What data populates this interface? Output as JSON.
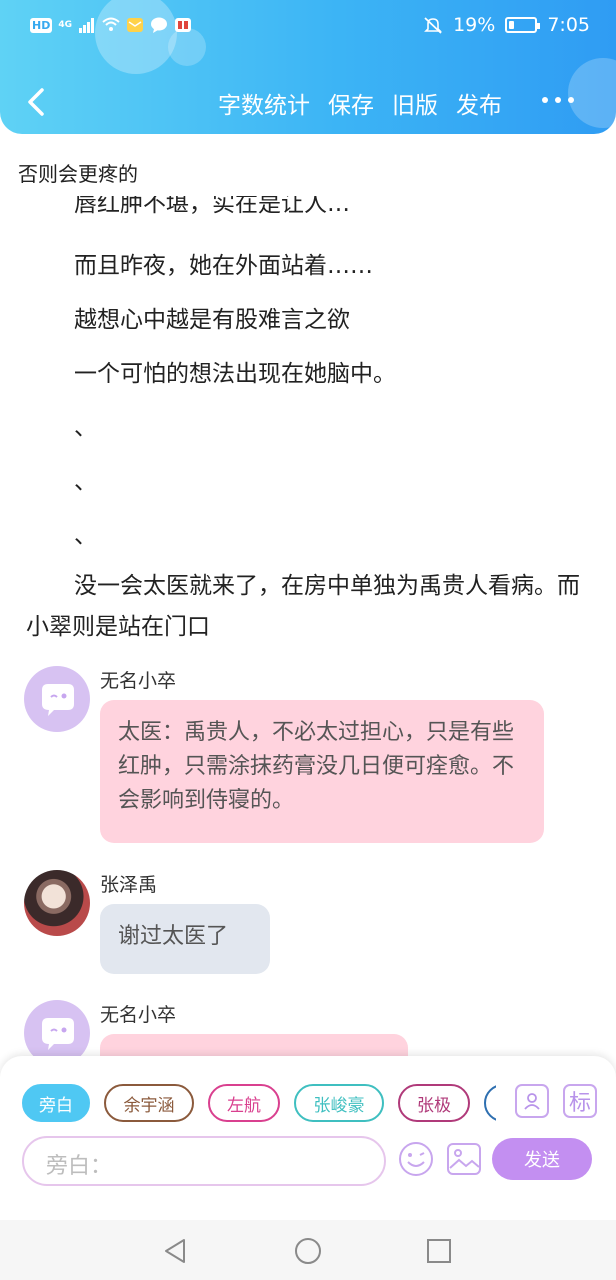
{
  "statusbar": {
    "hd": "HD",
    "network": "4G",
    "battery_percent": "19%",
    "battery_level": 0.19,
    "time": "7:05",
    "icons": [
      "signal-icon",
      "wifi-icon",
      "mail-app-icon",
      "chat-app-icon",
      "book-app-icon",
      "mute-icon",
      "battery-icon"
    ]
  },
  "navbar": {
    "word_count": "字数统计",
    "save": "保存",
    "old_version": "旧版",
    "publish": "发布"
  },
  "draft_title": "否则会更疼的",
  "content": {
    "clipped_line": "唇红肿不堪，实在是让人…",
    "p1": "而且昨夜，她在外面站着……",
    "p2": "越想心中越是有股难言之欲",
    "p3": "一个可怕的想法出现在她脑中。",
    "mark1": "、",
    "mark2": "、",
    "mark3": "、",
    "p4": "没一会太医就来了，在房中单独为禹贵人看病。而小翠则是站在门口"
  },
  "messages": [
    {
      "sender": "无名小卒",
      "text": "太医：禹贵人，不必太过担心，只是有些红肿，只需涂抹药膏没几日便可痊愈。不会影响到侍寝的。"
    },
    {
      "sender": "张泽禹",
      "text": "谢过太医了"
    },
    {
      "sender": "无名小卒",
      "text": ""
    }
  ],
  "composer": {
    "chips": [
      {
        "label": "旁白",
        "color": "#4fc8f3",
        "active": true
      },
      {
        "label": "余宇涵",
        "color": "#8b5a3c",
        "active": false
      },
      {
        "label": "左航",
        "color": "#d9408f",
        "active": false
      },
      {
        "label": "张峻豪",
        "color": "#3fbfc0",
        "active": false
      },
      {
        "label": "张极",
        "color": "#b03a7a",
        "active": false
      }
    ],
    "role_icon_label": "标",
    "input_placeholder": "旁白：",
    "send_label": "发送"
  },
  "colors": {
    "header_start": "#5fd2f5",
    "header_end": "#2f9cf3",
    "pink_bubble": "#ffd3de",
    "gray_bubble": "#e2e7ef",
    "send_button": "#c38ff1"
  }
}
